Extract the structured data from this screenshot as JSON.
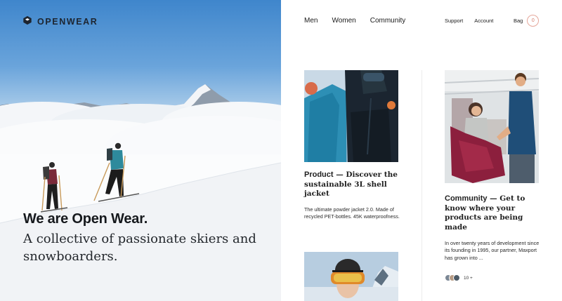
{
  "brand": {
    "name": "OPENWEAR",
    "icon": "hexagon-logo-icon"
  },
  "nav": {
    "main": [
      "Men",
      "Women",
      "Community"
    ],
    "utility": [
      "Support",
      "Account"
    ],
    "bag_label": "Bag",
    "bag_count": "0"
  },
  "hero": {
    "title": "We are Open Wear.",
    "subtitle": "A collective of passionate skiers and snowboarders."
  },
  "cards": [
    {
      "category": "Product",
      "heading_text": " — Discover the sustainable 3L shell jacket",
      "body": "The ultimate powder jacket 2.0. Made of recycled PET-bottles. 45K waterproofness."
    },
    {
      "category": "Community",
      "heading_text": " — Get to know where your products are being made",
      "body": "In over twenty years of development since its founding in 1995, our partner, Maxport has grown into ...",
      "avatar_count": "10 +"
    }
  ],
  "colors": {
    "accent": "#d47866",
    "text": "#1a1a1a",
    "sky": "#3f86cc"
  }
}
